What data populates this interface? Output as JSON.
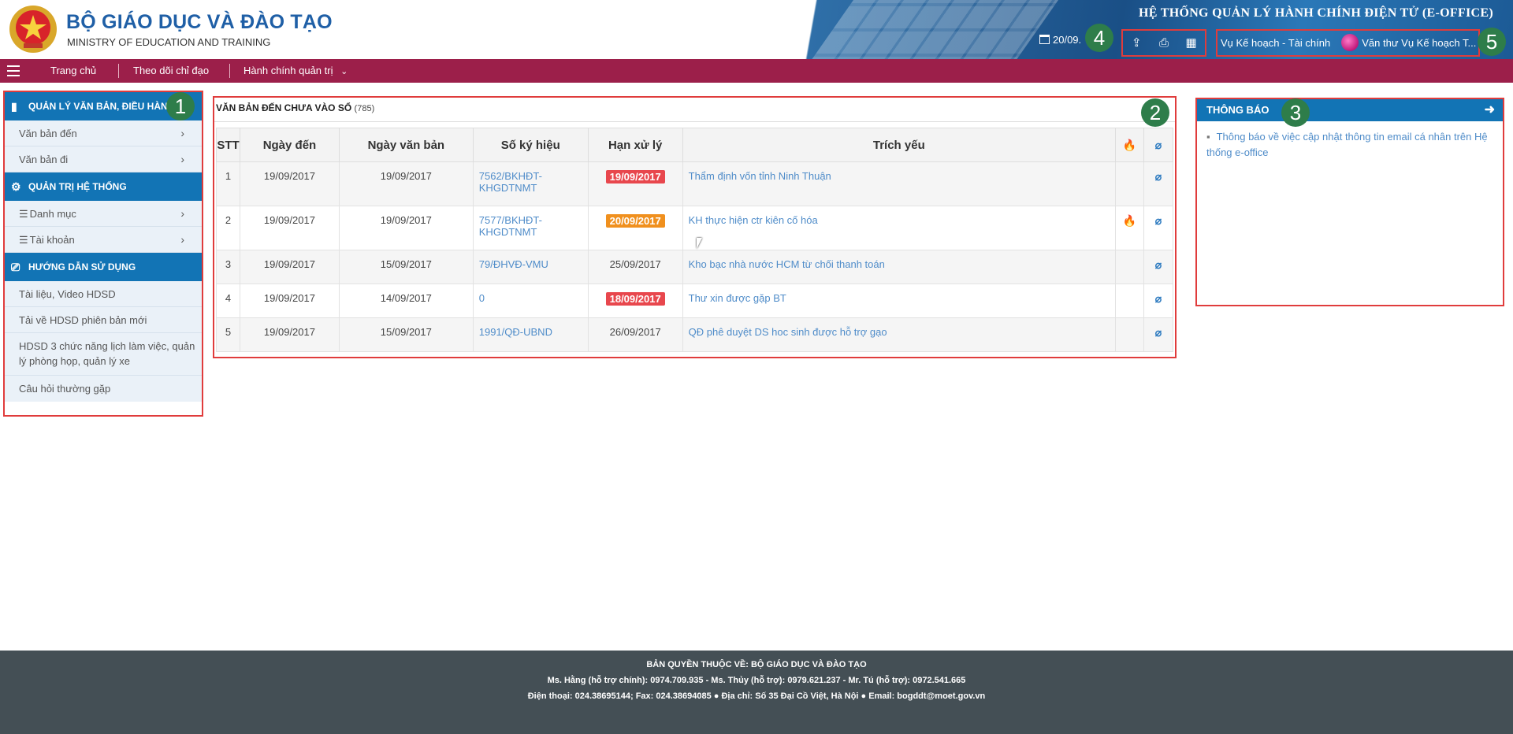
{
  "header": {
    "org_vi": "BỘ GIÁO DỤC VÀ ĐÀO TẠO",
    "org_en": "MINISTRY OF EDUCATION AND TRAINING",
    "system_title": "HỆ THỐNG QUẢN LÝ HÀNH CHÍNH ĐIỆN TỬ (E-OFFICE)",
    "date": "20/09.",
    "user_unit": "Vụ Kế hoạch - Tài chính",
    "user_name": "Văn thư Vụ Kế hoạch T...",
    "icons": [
      "upload-icon",
      "printer-icon",
      "calendar-clock-icon"
    ]
  },
  "nav": {
    "items": [
      "Trang chủ",
      "Theo dõi chỉ đạo",
      "Hành chính quản trị"
    ]
  },
  "sidebar": {
    "sections": [
      {
        "title": "QUẢN LÝ VĂN BẢN, ĐIỀU HÀNH",
        "icon": "door-icon",
        "items": [
          "Văn bản đến",
          "Văn bản đi"
        ]
      },
      {
        "title": "QUẢN TRỊ HỆ THỐNG",
        "icon": "gear-icon",
        "items": [
          "Danh mục",
          "Tài khoản"
        ]
      },
      {
        "title": "HƯỚNG DẪN SỬ DỤNG",
        "icon": "guide-icon",
        "items": [
          "Tài liệu, Video HDSD",
          "Tải về HDSD phiên bản mới",
          "HDSD 3 chức năng lịch làm việc, quản lý phòng họp, quản lý xe",
          "Câu hỏi thường gặp"
        ]
      }
    ]
  },
  "main": {
    "title": "VĂN BẢN ĐẾN CHƯA VÀO SỔ",
    "count": "(785)",
    "columns": [
      "STT",
      "Ngày đến",
      "Ngày văn bản",
      "Số ký hiệu",
      "Hạn xử lý",
      "Trích yếu"
    ],
    "rows": [
      {
        "stt": "1",
        "ngay_den": "19/09/2017",
        "ngay_vb": "19/09/2017",
        "so_ky_hieu": "7562/BKHĐT-KHGDTNMT",
        "han": "19/09/2017",
        "han_style": "red",
        "trich_yeu": "Thẩm định vốn tỉnh Ninh Thuận",
        "urgent": false
      },
      {
        "stt": "2",
        "ngay_den": "19/09/2017",
        "ngay_vb": "19/09/2017",
        "so_ky_hieu": "7577/BKHĐT-KHGDTNMT",
        "han": "20/09/2017",
        "han_style": "orange",
        "trich_yeu": "KH thực hiện ctr kiên cố hóa",
        "urgent": true
      },
      {
        "stt": "3",
        "ngay_den": "19/09/2017",
        "ngay_vb": "15/09/2017",
        "so_ky_hieu": "79/ĐHVĐ-VMU",
        "han": "25/09/2017",
        "han_style": "plain",
        "trich_yeu": "Kho bạc nhà nước HCM từ chối thanh toán",
        "urgent": false
      },
      {
        "stt": "4",
        "ngay_den": "19/09/2017",
        "ngay_vb": "14/09/2017",
        "so_ky_hieu": "0",
        "han": "18/09/2017",
        "han_style": "red",
        "trich_yeu": "Thư xin được gặp BT",
        "urgent": false
      },
      {
        "stt": "5",
        "ngay_den": "19/09/2017",
        "ngay_vb": "15/09/2017",
        "so_ky_hieu": "1991/QĐ-UBND",
        "han": "26/09/2017",
        "han_style": "plain",
        "trich_yeu": "QĐ phê duyệt DS hoc sinh được hỗ trợ gạo",
        "urgent": false
      }
    ]
  },
  "notice": {
    "title": "THÔNG BÁO",
    "items": [
      "Thông báo về việc cập nhật thông tin email cá nhân trên Hệ thống e-office"
    ]
  },
  "markers": [
    "1",
    "2",
    "3",
    "4",
    "5"
  ],
  "footer": {
    "line1": "BẢN QUYỀN THUỘC VỀ: BỘ GIÁO DỤC VÀ ĐÀO TẠO",
    "line2": "Ms. Hằng (hỗ trợ chính): 0974.709.935 - Ms. Thủy (hỗ trợ): 0979.621.237 - Mr. Tú (hỗ trợ): 0972.541.665",
    "line3": "Điện thoại: 024.38695144; Fax: 024.38694085 ● Địa chỉ: Số 35 Đại Cồ Việt, Hà Nội ● Email: bogddt@moet.gov.vn"
  },
  "colors": {
    "brand_blue": "#1274b5",
    "nav_bg": "#9c1f4a",
    "badge_red": "#e8474d",
    "badge_orange": "#f0901e",
    "marker_green": "#2e7d4a",
    "highlight_border": "#e03c3c"
  }
}
